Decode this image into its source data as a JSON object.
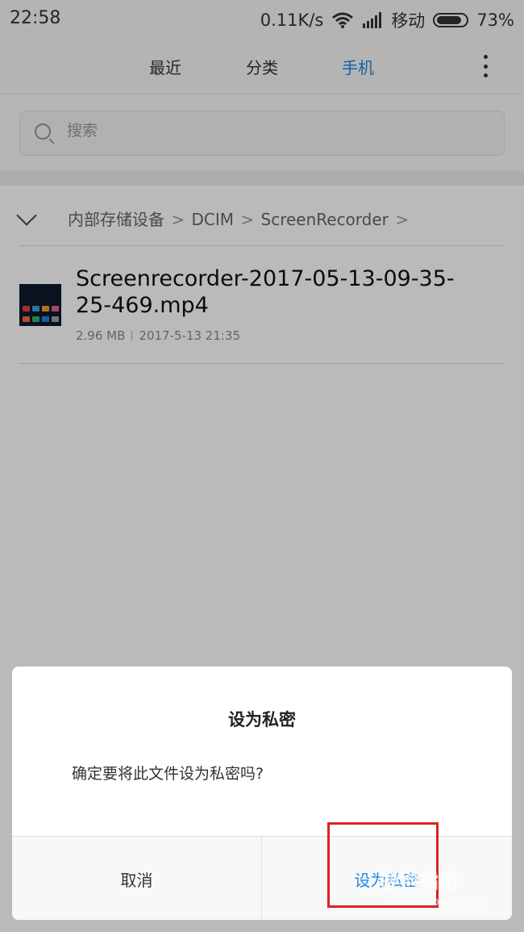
{
  "status_bar": {
    "time": "22:58",
    "speed": "0.11K/s",
    "carrier": "移动",
    "battery": "73%",
    "wifi_icon": "wifi-icon",
    "signal_icon": "signal-icon"
  },
  "tabs": [
    {
      "label": "最近",
      "active": false
    },
    {
      "label": "分类",
      "active": false
    },
    {
      "label": "手机",
      "active": true
    }
  ],
  "more_icon": "more-vertical-icon",
  "search": {
    "placeholder": "搜索"
  },
  "breadcrumb": {
    "items": [
      "内部存储设备",
      "DCIM",
      "ScreenRecorder"
    ],
    "separator": ">"
  },
  "file": {
    "name": "Screenrecorder-2017-05-13-09-35-25-469.mp4",
    "size": "2.96 MB",
    "date": "2017-5-13 21:35"
  },
  "dialog": {
    "title": "设为私密",
    "message": "确定要将此文件设为私密吗?",
    "cancel_label": "取消",
    "confirm_label": "设为私密"
  },
  "watermark": {
    "text": "搜狗指南",
    "sub": "zhinan.sogou.com"
  },
  "colors": {
    "accent": "#1e88e5",
    "highlight": "#e02020"
  }
}
